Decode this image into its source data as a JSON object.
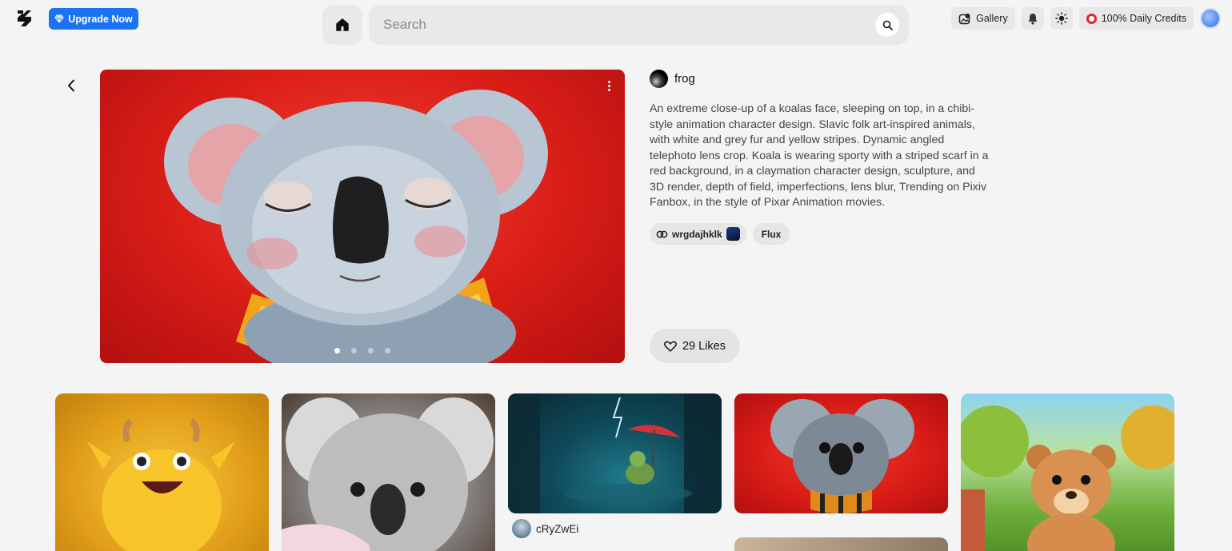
{
  "header": {
    "upgrade_label": "Upgrade Now",
    "search_placeholder": "Search",
    "gallery_label": "Gallery",
    "credits_label": "100% Daily Credits"
  },
  "post": {
    "author": "frog",
    "description": "An extreme close-up of a koalas face, sleeping on top, in a chibi-style animation character design. Slavic folk art-inspired animals, with white and grey fur and yellow stripes. Dynamic angled telephoto lens crop. Koala is wearing sporty with a striped scarf in a red background, in a claymation character design, sculpture, and 3D render, depth of field, imperfections, lens blur, Trending on Pixiv Fanbox, in the style of Pixar Animation movies.",
    "tags": [
      {
        "label": "wrgdajhklk"
      },
      {
        "label": "Flux"
      }
    ],
    "likes_label": "29 Likes",
    "carousel": {
      "count": 4,
      "active_index": 0
    }
  },
  "gallery": {
    "cards": [
      {
        "subject": "yellow furry monster"
      },
      {
        "subject": "koala in pink blanket"
      },
      {
        "subject": "turtle with red umbrella in rain",
        "owner": "cRyZwEi"
      },
      {
        "subject": "koala with orange scarf"
      },
      {
        "subject": "teddy bear in forest"
      },
      {
        "subject": "partial image"
      }
    ]
  },
  "colors": {
    "accent": "#1a73f0",
    "credit_ring": "#e0262d",
    "background": "#f4f4f4"
  }
}
